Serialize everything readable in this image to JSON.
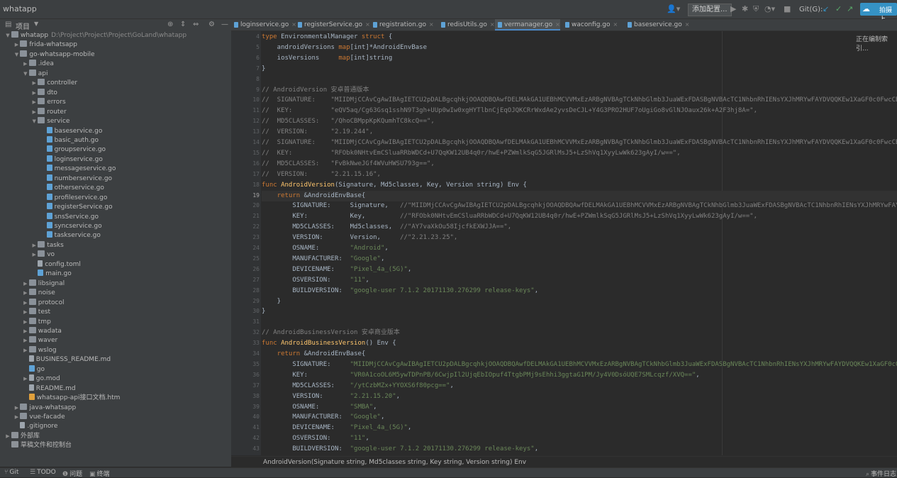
{
  "app": {
    "title": "whatapp"
  },
  "toolbar": {
    "config_label": "添加配置...",
    "git_label": "Git(G):",
    "share_label": "拍摄上"
  },
  "project_panel": {
    "header": "项目",
    "tree": [
      {
        "depth": 0,
        "arrow": "open",
        "kind": "folder",
        "label": "whatapp",
        "path": "D:\\Project\\Project\\Project\\GoLand\\whatapp"
      },
      {
        "depth": 1,
        "arrow": "closed",
        "kind": "folder",
        "label": "frida-whatsapp"
      },
      {
        "depth": 1,
        "arrow": "open",
        "kind": "folder",
        "label": "go-whatsapp-mobile"
      },
      {
        "depth": 2,
        "arrow": "closed",
        "kind": "folder",
        "label": ".idea"
      },
      {
        "depth": 2,
        "arrow": "open",
        "kind": "folder",
        "label": "api"
      },
      {
        "depth": 3,
        "arrow": "closed",
        "kind": "folder",
        "label": "controller"
      },
      {
        "depth": 3,
        "arrow": "closed",
        "kind": "folder",
        "label": "dto"
      },
      {
        "depth": 3,
        "arrow": "closed",
        "kind": "folder",
        "label": "errors"
      },
      {
        "depth": 3,
        "arrow": "closed",
        "kind": "folder",
        "label": "router"
      },
      {
        "depth": 3,
        "arrow": "open",
        "kind": "folder",
        "label": "service"
      },
      {
        "depth": 4,
        "arrow": "",
        "kind": "gofile",
        "label": "baseservice.go"
      },
      {
        "depth": 4,
        "arrow": "",
        "kind": "gofile",
        "label": "basic_auth.go"
      },
      {
        "depth": 4,
        "arrow": "",
        "kind": "gofile",
        "label": "groupservice.go"
      },
      {
        "depth": 4,
        "arrow": "",
        "kind": "gofile",
        "label": "loginservice.go"
      },
      {
        "depth": 4,
        "arrow": "",
        "kind": "gofile",
        "label": "messageservice.go"
      },
      {
        "depth": 4,
        "arrow": "",
        "kind": "gofile",
        "label": "numberservice.go"
      },
      {
        "depth": 4,
        "arrow": "",
        "kind": "gofile",
        "label": "otherservice.go"
      },
      {
        "depth": 4,
        "arrow": "",
        "kind": "gofile",
        "label": "profileservice.go"
      },
      {
        "depth": 4,
        "arrow": "",
        "kind": "gofile",
        "label": "registerService.go"
      },
      {
        "depth": 4,
        "arrow": "",
        "kind": "gofile",
        "label": "snsService.go"
      },
      {
        "depth": 4,
        "arrow": "",
        "kind": "gofile",
        "label": "syncservice.go"
      },
      {
        "depth": 4,
        "arrow": "",
        "kind": "gofile",
        "label": "taskservice.go"
      },
      {
        "depth": 3,
        "arrow": "closed",
        "kind": "folder",
        "label": "tasks"
      },
      {
        "depth": 3,
        "arrow": "closed",
        "kind": "folder",
        "label": "vo"
      },
      {
        "depth": 3,
        "arrow": "",
        "kind": "file",
        "label": "config.toml"
      },
      {
        "depth": 3,
        "arrow": "",
        "kind": "gofile",
        "label": "main.go"
      },
      {
        "depth": 2,
        "arrow": "closed",
        "kind": "folder",
        "label": "libsignal"
      },
      {
        "depth": 2,
        "arrow": "closed",
        "kind": "folder",
        "label": "noise"
      },
      {
        "depth": 2,
        "arrow": "closed",
        "kind": "folder",
        "label": "protocol"
      },
      {
        "depth": 2,
        "arrow": "closed",
        "kind": "folder",
        "label": "test"
      },
      {
        "depth": 2,
        "arrow": "closed",
        "kind": "folder",
        "label": "tmp"
      },
      {
        "depth": 2,
        "arrow": "closed",
        "kind": "folder",
        "label": "wadata"
      },
      {
        "depth": 2,
        "arrow": "closed",
        "kind": "folder",
        "label": "waver"
      },
      {
        "depth": 2,
        "arrow": "closed",
        "kind": "folder",
        "label": "wslog"
      },
      {
        "depth": 2,
        "arrow": "",
        "kind": "file",
        "label": "BUSINESS_README.md"
      },
      {
        "depth": 2,
        "arrow": "",
        "kind": "gofile",
        "label": "go"
      },
      {
        "depth": 2,
        "arrow": "closed",
        "kind": "file",
        "label": "go.mod"
      },
      {
        "depth": 2,
        "arrow": "",
        "kind": "file",
        "label": "README.md"
      },
      {
        "depth": 2,
        "arrow": "",
        "kind": "htm",
        "label": "whatsapp-api接口文档.htm"
      },
      {
        "depth": 1,
        "arrow": "closed",
        "kind": "folder",
        "label": "java-whatsapp"
      },
      {
        "depth": 1,
        "arrow": "closed",
        "kind": "folder",
        "label": "vue-facade"
      },
      {
        "depth": 1,
        "arrow": "",
        "kind": "file",
        "label": ".gitignore"
      },
      {
        "depth": 0,
        "arrow": "closed",
        "kind": "lib",
        "label": "外部库"
      },
      {
        "depth": 0,
        "arrow": "",
        "kind": "lib",
        "label": "草稿文件和控制台"
      }
    ]
  },
  "tabs": [
    {
      "label": "loginservice.go",
      "active": false
    },
    {
      "label": "registerService.go",
      "active": false
    },
    {
      "label": "registration.go",
      "active": false
    },
    {
      "label": "redisUtils.go",
      "active": false
    },
    {
      "label": "vermanager.go",
      "active": true
    },
    {
      "label": "waconfig.go",
      "active": false
    },
    {
      "label": "baseservice.go",
      "active": false
    }
  ],
  "editor": {
    "indexing_label": "正在编制索引...",
    "current_line": 19,
    "lines": [
      {
        "n": 4,
        "segs": [
          [
            "kw",
            "type "
          ],
          [
            "ty",
            "EnvironmentalManager "
          ],
          [
            "kw",
            "struct"
          ],
          [
            "ty",
            " {"
          ]
        ]
      },
      {
        "n": 5,
        "segs": [
          [
            "ty",
            "    androidVersions "
          ],
          [
            "kw",
            "map"
          ],
          [
            "ty",
            "[int]*AndroidEnvBase"
          ]
        ]
      },
      {
        "n": 6,
        "segs": [
          [
            "ty",
            "    iosVersions     "
          ],
          [
            "kw",
            "map"
          ],
          [
            "ty",
            "[int]string"
          ]
        ]
      },
      {
        "n": 7,
        "segs": [
          [
            "ty",
            "}"
          ]
        ]
      },
      {
        "n": 8,
        "segs": []
      },
      {
        "n": 9,
        "segs": [
          [
            "cm",
            "// AndroidVersion 安卓普通版本"
          ]
        ]
      },
      {
        "n": 10,
        "segs": [
          [
            "cm",
            "//  SIGNATURE:    \"MIIDMjCCAvCgAwIBAgIETCU2pDALBgcqhkjOOAQDBQAwfDELMAkGA1UEBhMCVVMxEzARBgNVBAgTCkNhbGlmb3JuaWExFDASBgNVBAcTC1NhbnRhIENsYXJhMRYwFAYDVQQKEw1XaGF0c0FwcCBJ"
          ]
        ]
      },
      {
        "n": 11,
        "segs": [
          [
            "cm",
            "//  KEY:          \"eQV5aq/Cg63Gsq1sshN9T3gh+UUp0wIw0xgHYTlbnCjEqOJQKCRrWxdAe2yvsDeCJL+Y4G3PRO2HUF7oUgiGo8vGlNJOaux26k+A2F3hj8A=\","
          ]
        ]
      },
      {
        "n": 12,
        "segs": [
          [
            "cm",
            "//  MD5CLASSES:   \"/QhoCBMppKpKQumhTC8kcQ==\","
          ]
        ]
      },
      {
        "n": 13,
        "segs": [
          [
            "cm",
            "//  VERSION:      \"2.19.244\","
          ]
        ]
      },
      {
        "n": 14,
        "segs": [
          [
            "cm",
            "//  SIGNATURE:    \"MIIDMjCCAvCgAwIBAgIETCU2pDALBgcqhkjOOAQDBQAwfDELMAkGA1UEBhMCVVMxEzARBgNVBAgTCkNhbGlmb3JuaWExFDASBgNVBAcTC1NhbnRhIENsYXJhMRYwFAYDVQQKEw1XaGF0c0FwcCBJ"
          ]
        ]
      },
      {
        "n": 15,
        "segs": [
          [
            "cm",
            "//  KEY:          \"RFObk0NHtvEmCSluaRRbWDCd+U7QqKW12UB4q0r/hwE+PZWmlkSqG5JGRlMsJ5+LzShVq1XyyLwWk623gAyI/w==\","
          ]
        ]
      },
      {
        "n": 16,
        "segs": [
          [
            "cm",
            "//  MD5CLASSES:   \"FvBkNweJGf4WVuHWSU793g==\","
          ]
        ]
      },
      {
        "n": 17,
        "segs": [
          [
            "cm",
            "//  VERSION:      \"2.21.15.16\","
          ]
        ]
      },
      {
        "n": 18,
        "segs": [
          [
            "kw",
            "func "
          ],
          [
            "fn",
            "AndroidVersion"
          ],
          [
            "ty",
            "(Signature, Md5classes, Key, Version string) Env {"
          ]
        ]
      },
      {
        "n": 19,
        "segs": [
          [
            "ty",
            "    "
          ],
          [
            "kw",
            "return "
          ],
          [
            "ty",
            "&AndroidEnvBase{"
          ]
        ]
      },
      {
        "n": 20,
        "segs": [
          [
            "ty",
            "        SIGNATURE:     Signature,   "
          ],
          [
            "cm",
            "//\"MIIDMjCCAvCgAwIBAgIETCU2pDALBgcqhkjOOAQDBQAwfDELMAkGA1UEBhMCVVMxEzARBgNVBAgTCkNhbGlmb3JuaWExFDASBgNVBAcTC1NhbnRhIENsYXJhMRYwFAYDVQQKEw1XaGF0"
          ]
        ]
      },
      {
        "n": 21,
        "segs": [
          [
            "ty",
            "        KEY:           Key,         "
          ],
          [
            "cm",
            "//\"RFObk0NHtvEmCSluaRRbWDCd+U7QqKW12UB4q0r/hwE+PZWmlkSqG5JGRlMsJ5+LzShVq1XyyLwWk623gAyI/w==\","
          ]
        ]
      },
      {
        "n": 22,
        "segs": [
          [
            "ty",
            "        MD5CLASSES:    Md5classes,  "
          ],
          [
            "cm",
            "//\"AY7vaXkOu58IjcfkEXWJJA==\","
          ]
        ]
      },
      {
        "n": 23,
        "segs": [
          [
            "ty",
            "        VERSION:       Version,     "
          ],
          [
            "cm",
            "//\"2.21.23.25\","
          ]
        ]
      },
      {
        "n": 24,
        "segs": [
          [
            "ty",
            "        OSNAME:        "
          ],
          [
            "str",
            "\"Android\""
          ],
          [
            "ty",
            ","
          ]
        ]
      },
      {
        "n": 25,
        "segs": [
          [
            "ty",
            "        MANUFACTURER:  "
          ],
          [
            "str",
            "\"Google\""
          ],
          [
            "ty",
            ","
          ]
        ]
      },
      {
        "n": 26,
        "segs": [
          [
            "ty",
            "        DEVICENAME:    "
          ],
          [
            "str",
            "\"Pixel_4a_(5G)\""
          ],
          [
            "ty",
            ","
          ]
        ]
      },
      {
        "n": 27,
        "segs": [
          [
            "ty",
            "        OSVERSION:     "
          ],
          [
            "str",
            "\"11\""
          ],
          [
            "ty",
            ","
          ]
        ]
      },
      {
        "n": 28,
        "segs": [
          [
            "ty",
            "        BUILDVERSION:  "
          ],
          [
            "str",
            "\"google-user 7.1.2 20171130.276299 release-keys\""
          ],
          [
            "ty",
            ","
          ]
        ]
      },
      {
        "n": 29,
        "segs": [
          [
            "ty",
            "    }"
          ]
        ]
      },
      {
        "n": 30,
        "segs": [
          [
            "ty",
            "}"
          ]
        ]
      },
      {
        "n": 31,
        "segs": []
      },
      {
        "n": 32,
        "segs": [
          [
            "cm",
            "// AndroidBusinessVersion 安卓商业版本"
          ]
        ]
      },
      {
        "n": 33,
        "segs": [
          [
            "kw",
            "func "
          ],
          [
            "fn",
            "AndroidBusinessVersion"
          ],
          [
            "ty",
            "() Env {"
          ]
        ]
      },
      {
        "n": 34,
        "segs": [
          [
            "ty",
            "    "
          ],
          [
            "kw",
            "return "
          ],
          [
            "ty",
            "&AndroidEnvBase{"
          ]
        ]
      },
      {
        "n": 35,
        "segs": [
          [
            "ty",
            "        SIGNATURE:     "
          ],
          [
            "str",
            "\"MIIDMjCCAvCgAwIBAgIETCU2pDALBgcqhkjOOAQDBQAwfDELMAkGA1UEBhMCVVMxEzARBgNVBAgTCkNhbGlmb3JuaWExFDASBgNVBAcTC1NhbnRhIENsYXJhMRYwFAYDVQQKEw1XaGF0c0FwcCBJ"
          ]
        ]
      },
      {
        "n": 36,
        "segs": [
          [
            "ty",
            "        KEY:           "
          ],
          [
            "str",
            "\"VR0A1coOL6M5ywTDPnPB/6CwjpIl2UjqEbIOpuf4TtgbPMj9sEhhi3ggtaG1PM/Jy4V0DsóUQE7SMLcqzf/XVQ==\""
          ],
          [
            "ty",
            ","
          ]
        ]
      },
      {
        "n": 37,
        "segs": [
          [
            "ty",
            "        MD5CLASSES:    "
          ],
          [
            "str",
            "\"/ytCzbMZx+YYOXS6f80pcg==\""
          ],
          [
            "ty",
            ","
          ]
        ]
      },
      {
        "n": 38,
        "segs": [
          [
            "ty",
            "        VERSION:       "
          ],
          [
            "str",
            "\"2.21.15.20\""
          ],
          [
            "ty",
            ","
          ]
        ]
      },
      {
        "n": 39,
        "segs": [
          [
            "ty",
            "        OSNAME:        "
          ],
          [
            "str",
            "\"SMBA\""
          ],
          [
            "ty",
            ","
          ]
        ]
      },
      {
        "n": 40,
        "segs": [
          [
            "ty",
            "        MANUFACTURER:  "
          ],
          [
            "str",
            "\"Google\""
          ],
          [
            "ty",
            ","
          ]
        ]
      },
      {
        "n": 41,
        "segs": [
          [
            "ty",
            "        DEVICENAME:    "
          ],
          [
            "str",
            "\"Pixel_4a_(5G)\""
          ],
          [
            "ty",
            ","
          ]
        ]
      },
      {
        "n": 42,
        "segs": [
          [
            "ty",
            "        OSVERSION:     "
          ],
          [
            "str",
            "\"11\""
          ],
          [
            "ty",
            ","
          ]
        ]
      },
      {
        "n": 43,
        "segs": [
          [
            "ty",
            "        BUILDVERSION:  "
          ],
          [
            "str",
            "\"google-user 7.1.2 20171130.276299 release-keys\""
          ],
          [
            "ty",
            ","
          ]
        ]
      }
    ]
  },
  "breadcrumb": "AndroidVersion(Signature string, Md5classes string, Key string, Version string) Env",
  "statusbar": {
    "items": [
      {
        "icon": "git-icon",
        "glyph": "⑂",
        "label": "Git"
      },
      {
        "icon": "todo-icon",
        "glyph": "☰",
        "label": "TODO"
      },
      {
        "icon": "problems-icon",
        "glyph": "❶",
        "label": "问题"
      },
      {
        "icon": "terminal-icon",
        "glyph": "▣",
        "label": "终端"
      }
    ],
    "event_log": "事件日志"
  }
}
